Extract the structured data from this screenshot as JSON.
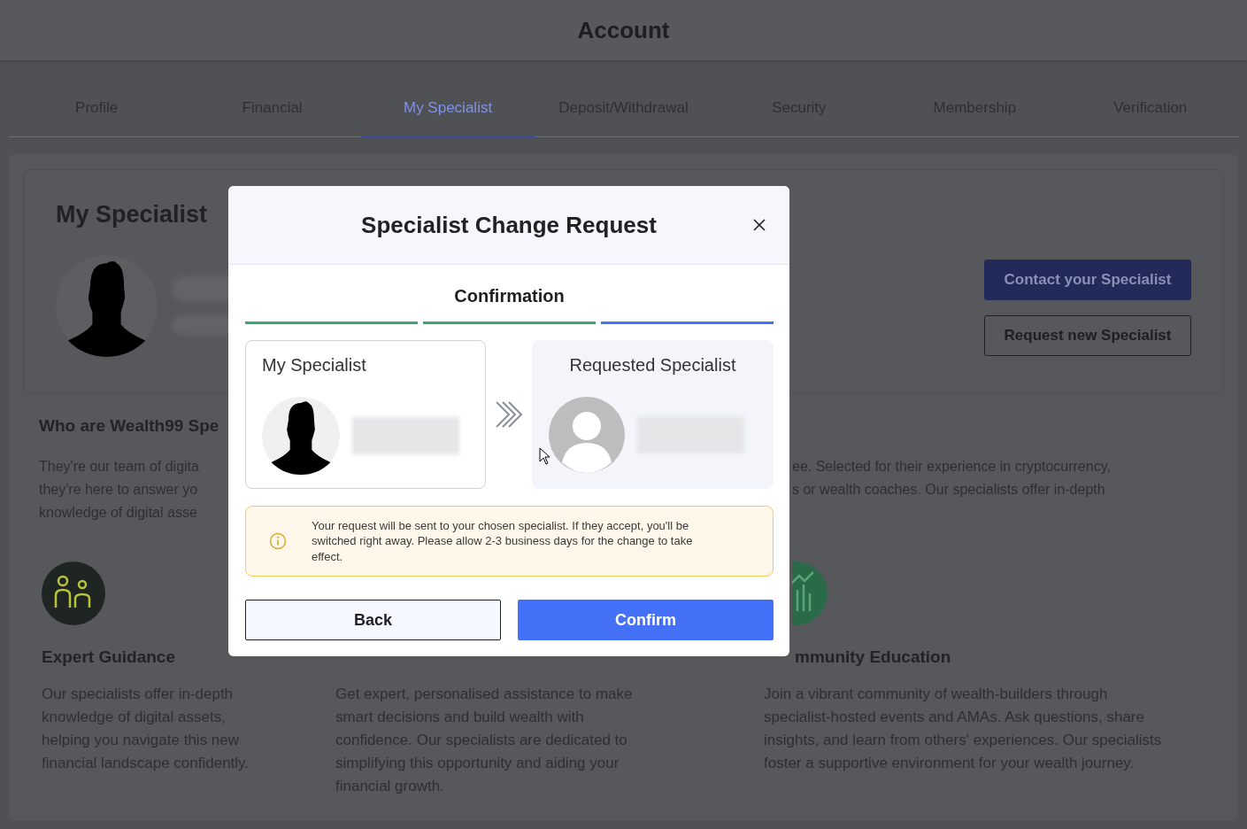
{
  "header": {
    "title": "Account"
  },
  "tabs": [
    {
      "label": "Profile",
      "selected": false
    },
    {
      "label": "Financial",
      "selected": false
    },
    {
      "label": "My Specialist",
      "selected": true
    },
    {
      "label": "Deposit/Withdrawal",
      "selected": false
    },
    {
      "label": "Security",
      "selected": false
    },
    {
      "label": "Membership",
      "selected": false
    },
    {
      "label": "Verification",
      "selected": false
    }
  ],
  "specialist_card": {
    "title": "My Specialist",
    "buttons": [
      {
        "label": "Contact your Specialist",
        "kind": "primary"
      },
      {
        "label": "Request new Specialist",
        "kind": "outline"
      }
    ]
  },
  "about": {
    "heading": "Who are Wealth99 Spe",
    "lines_left": [
      "They're our team of digita",
      "they're here to answer yo",
      "knowledge of digital asse"
    ],
    "lines_right": [
      "ee. Selected for their experience in cryptocurrency,",
      "s or wealth coaches. Our specialists offer in-depth"
    ]
  },
  "features": [
    {
      "title": "Expert Guidance",
      "body": "Our specialists offer in-depth knowledge of digital assets, helping you navigate this new financial landscape confidently."
    },
    {
      "body": "Get expert, personalised assistance to make smart decisions and build wealth with confidence. Our specialists are dedicated to simplifying this opportunity and aiding your financial growth."
    },
    {
      "title": "mmunity Education",
      "body": "Join a vibrant community of wealth-builders through specialist-hosted events and AMAs. Ask questions, share insights, and learn from others' experiences. Our specialists foster a supportive environment for your wealth journey."
    }
  ],
  "modal": {
    "title": "Specialist Change Request",
    "step_title": "Confirmation",
    "steps": [
      {
        "completed": true
      },
      {
        "completed": true
      },
      {
        "completed": false
      }
    ],
    "current": {
      "label": "My Specialist"
    },
    "requested": {
      "label": "Requested Specialist"
    },
    "notice": "Your request will be sent to your chosen specialist. If they accept, you'll be switched right away. Please allow 2-3 business days for the change to take effect.",
    "buttons": [
      {
        "label": "Back",
        "kind": "secondary"
      },
      {
        "label": "Confirm",
        "kind": "primary"
      }
    ]
  }
}
